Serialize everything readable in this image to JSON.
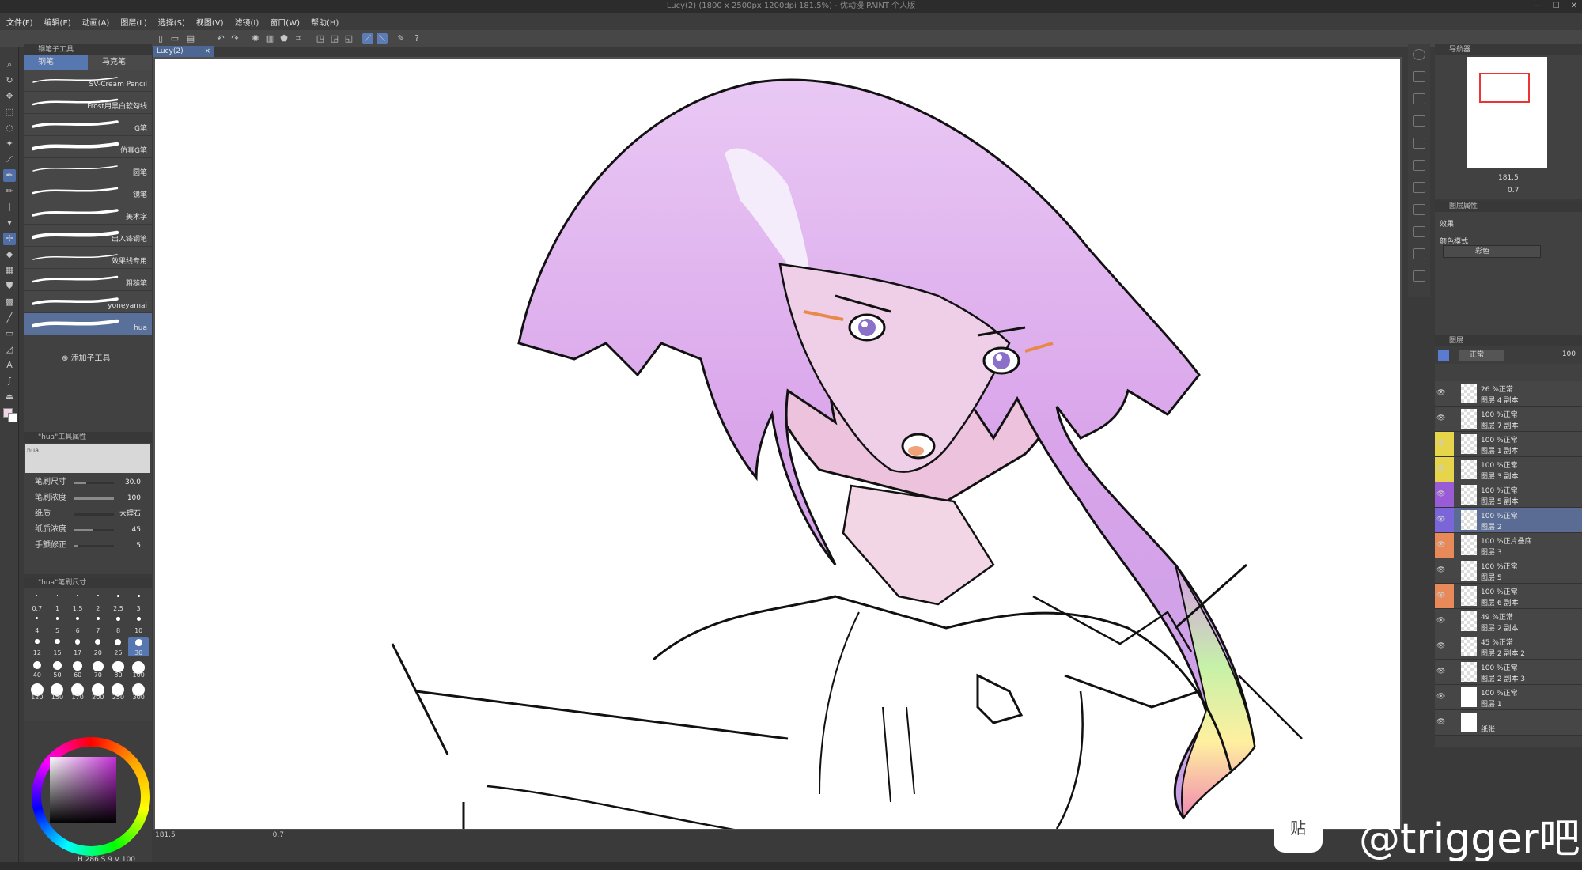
{
  "title": "Lucy(2) (1800 x 2500px 1200dpi 181.5%) - 优动漫 PAINT 个人版",
  "menu": [
    "文件(F)",
    "编辑(E)",
    "动画(A)",
    "图层(L)",
    "选择(S)",
    "视图(V)",
    "滤镜(I)",
    "窗口(W)",
    "帮助(H)"
  ],
  "subtool": {
    "header": "钢笔子工具",
    "tabs": [
      "钢笔",
      "马克笔"
    ],
    "brushes": [
      "SV-Cream Pencil",
      "Frost用黑白软勾线",
      "G笔",
      "仿真G笔",
      "圆笔",
      "镜笔",
      "美术字",
      "出入锋钢笔",
      "效果线专用",
      "粗糙笔",
      "yoneyamai",
      "hua"
    ],
    "add_label": "添加子工具"
  },
  "props": {
    "header": "\"hua\"工具属性",
    "preview_label": "hua",
    "rows": [
      {
        "label": "笔刷尺寸",
        "value": "30.0",
        "fill": 0.3
      },
      {
        "label": "笔刷浓度",
        "value": "100",
        "fill": 1.0
      },
      {
        "label": "纸质",
        "value": "大理石",
        "fill": 0
      },
      {
        "label": "纸质浓度",
        "value": "45",
        "fill": 0.45
      },
      {
        "label": "手颤修正",
        "value": "5",
        "fill": 0.1
      }
    ]
  },
  "sizes": {
    "header": "\"hua\"笔刷尺寸",
    "items": [
      "0.7",
      "1",
      "1.5",
      "2",
      "2.5",
      "3",
      "4",
      "5",
      "6",
      "7",
      "8",
      "10",
      "12",
      "15",
      "17",
      "20",
      "25",
      "30",
      "40",
      "50",
      "60",
      "70",
      "80",
      "100",
      "120",
      "150",
      "170",
      "200",
      "250",
      "300"
    ],
    "selected": "30"
  },
  "color": {
    "info": "H 286 S 9 V 100"
  },
  "document": {
    "tab": "Lucy(2)",
    "zoom": "181.5",
    "angle": "0.7"
  },
  "navigator": {
    "header": "导航器",
    "zoom": "181.5",
    "angle": "0.7"
  },
  "layerprop": {
    "header": "图层属性",
    "effect_label": "效果",
    "colormode_label": "颜色模式",
    "colormode_value": "彩色"
  },
  "layers": {
    "header": "图层",
    "blend": "正常",
    "opacity": "100",
    "items": [
      {
        "mode": "26 %正常",
        "name": "图层 4 副本",
        "color": "",
        "sel": false
      },
      {
        "mode": "100 %正常",
        "name": "图层 7 副本",
        "color": "",
        "sel": false
      },
      {
        "mode": "100 %正常",
        "name": "图层 1 副本",
        "color": "#e6d44a",
        "sel": false
      },
      {
        "mode": "100 %正常",
        "name": "图层 3 副本",
        "color": "#e6d44a",
        "sel": false
      },
      {
        "mode": "100 %正常",
        "name": "图层 5 副本",
        "color": "#9a5bd6",
        "sel": false
      },
      {
        "mode": "100 %正常",
        "name": "图层 2",
        "color": "#7a66d8",
        "sel": true
      },
      {
        "mode": "100 %正片叠底",
        "name": "图层 3",
        "color": "#e8895a",
        "sel": false
      },
      {
        "mode": "100 %正常",
        "name": "图层 5",
        "color": "",
        "sel": false
      },
      {
        "mode": "100 %正常",
        "name": "图层 6 副本",
        "color": "#e8895a",
        "sel": false
      },
      {
        "mode": "49 %正常",
        "name": "图层 2 副本",
        "color": "",
        "sel": false
      },
      {
        "mode": "45 %正常",
        "name": "图层 2 副本 2",
        "color": "",
        "sel": false
      },
      {
        "mode": "100 %正常",
        "name": "图层 2 副本 3",
        "color": "",
        "sel": false
      },
      {
        "mode": "100 %正常",
        "name": "图层 1",
        "color": "",
        "sel": false
      },
      {
        "mode": "",
        "name": "纸张",
        "color": "",
        "sel": false
      }
    ]
  },
  "watermark": {
    "text": "@trigger吧",
    "logo": "贴"
  }
}
